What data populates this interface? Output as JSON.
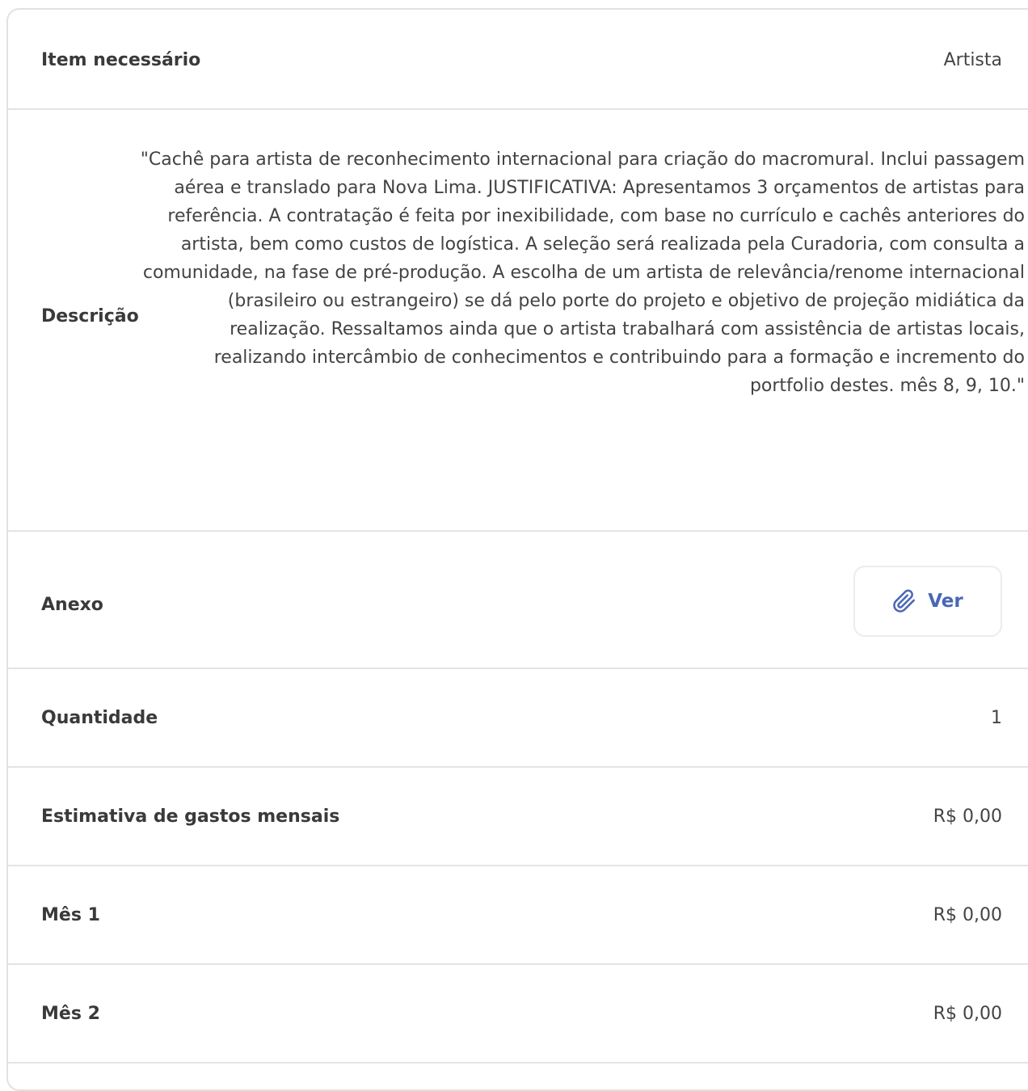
{
  "item": {
    "label": "Item necessário",
    "value": "Artista"
  },
  "descricao": {
    "label": "Descrição",
    "value": "\"Cachê para artista de reconhecimento internacional para criação do macromural. Inclui passagem aérea e translado para Nova Lima. JUSTIFICATIVA: Apresentamos 3 orçamentos de artistas para referência. A contratação é feita por inexibilidade, com base no currículo e cachês anteriores do artista, bem como custos de logística. A seleção será realizada pela Curadoria, com consulta a comunidade, na fase de pré-produção. A escolha de um artista de relevância/renome internacional (brasileiro ou estrangeiro) se dá pelo porte do projeto e objetivo de projeção midiática da realização. Ressaltamos ainda que o artista trabalhará com assistência de artistas locais, realizando intercâmbio de conhecimentos e contribuindo para a formação e incremento do portfolio destes. mês 8, 9, 10.\""
  },
  "anexo": {
    "label": "Anexo",
    "button_label": "Ver",
    "icon": "paperclip-icon",
    "accent_color": "#4a67b6"
  },
  "quantidade": {
    "label": "Quantidade",
    "value": "1"
  },
  "estimativa": {
    "label": "Estimativa de gastos mensais",
    "value": "R$ 0,00"
  },
  "mes1": {
    "label": "Mês 1",
    "value": "R$ 0,00"
  },
  "mes2": {
    "label": "Mês 2",
    "value": "R$ 0,00"
  }
}
